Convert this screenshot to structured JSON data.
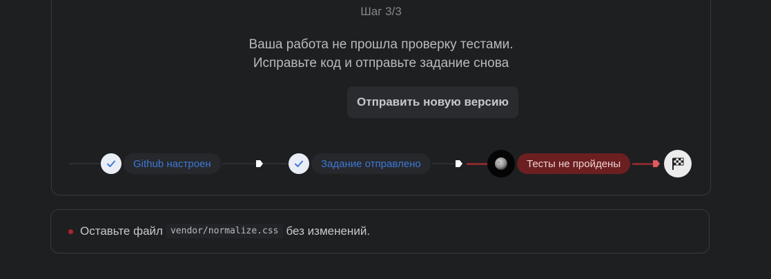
{
  "step": {
    "label": "Шаг 3/3"
  },
  "message": {
    "line1": "Ваша работа не прошла проверку тестами.",
    "line2": "Исправьте код и отправьте задание снова"
  },
  "actions": {
    "submit_label": "Отправить новую версию"
  },
  "progress": {
    "steps": [
      {
        "label": "Github настроен",
        "status": "done",
        "icon": "check-icon"
      },
      {
        "label": "Задание отправлено",
        "status": "done",
        "icon": "check-icon"
      },
      {
        "label": "Тесты не пройдены",
        "status": "failed",
        "icon": "moon-icon"
      },
      {
        "label": "",
        "status": "pending",
        "icon": "checkered-flag-icon"
      }
    ]
  },
  "hint": {
    "prefix": "Оставьте файл",
    "code": "vendor/normalize.css",
    "suffix": "без изменений."
  },
  "colors": {
    "background": "#1e1f21",
    "accent_blue": "#3f78d6",
    "fail_red": "#6b1f21",
    "bullet_red": "#b0242a"
  }
}
